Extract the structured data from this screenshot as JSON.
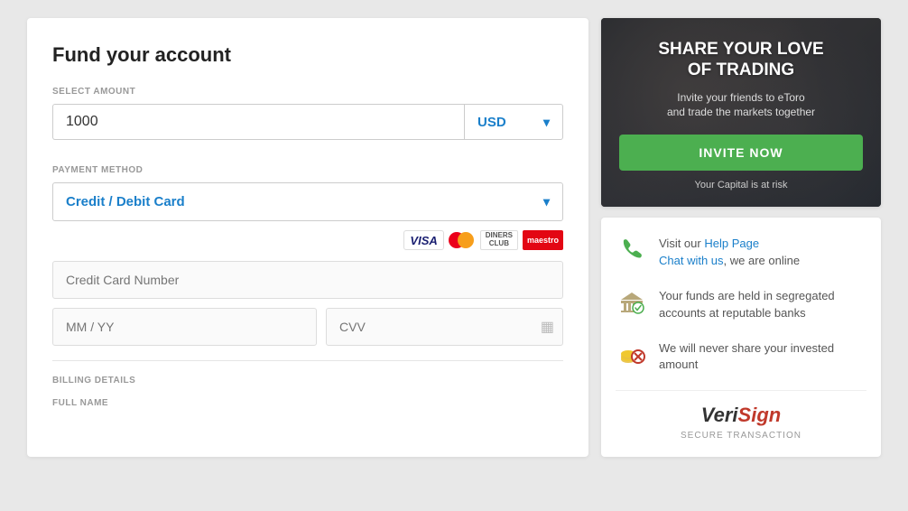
{
  "page": {
    "title": "Fund your account"
  },
  "left": {
    "title": "Fund your account",
    "selectAmountLabel": "SELECT AMOUNT",
    "amountValue": "1000",
    "currencyValue": "USD",
    "paymentMethodLabel": "PAYMENT METHOD",
    "paymentMethodValue": "Credit / Debit Card",
    "cardNumberPlaceholder": "Credit Card Number",
    "expPlaceholder": "MM / YY",
    "cvvPlaceholder": "CVV",
    "billingLabel": "BILLING DETAILS",
    "fullNameLabel": "FULL NAME"
  },
  "invite": {
    "title": "SHARE YOUR LOVE\nOF TRADING",
    "subtitle": "Invite your friends to eToro\nand trade the markets together",
    "buttonLabel": "INVITE NOW",
    "riskText": "Your Capital is at risk"
  },
  "info": {
    "item1": {
      "linkText1": "Help Page",
      "linkText2": "Chat with us",
      "text": ", we are online"
    },
    "item1prefix": "Visit our ",
    "item2": "Your funds are held in segregated accounts at reputable banks",
    "item3": "We will never share your invested amount",
    "verisign": "VeriSign",
    "secureLabel": "SECURE TRANSACTION"
  }
}
